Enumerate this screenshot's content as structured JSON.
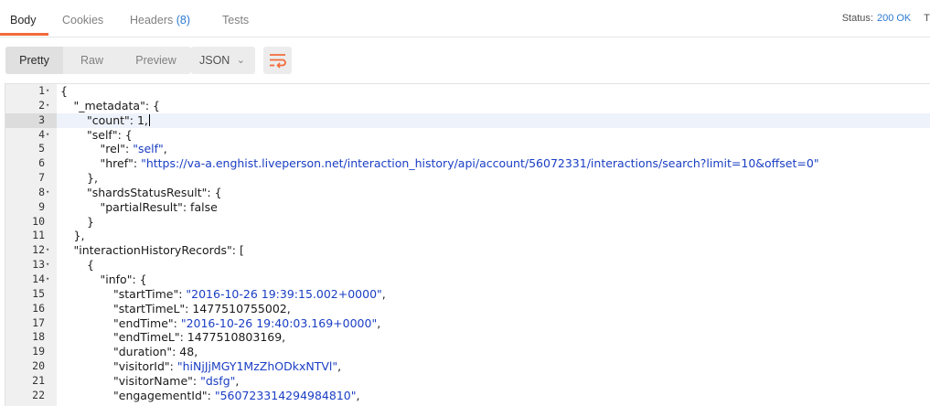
{
  "tabs": [
    {
      "label": "Body",
      "active": true
    },
    {
      "label": "Cookies",
      "active": false
    },
    {
      "label": "Headers",
      "count": "(8)",
      "active": false
    },
    {
      "label": "Tests",
      "active": false
    }
  ],
  "status": {
    "label": "Status:",
    "value": "200 OK",
    "trail": "T"
  },
  "toolbar": {
    "view_modes": [
      "Pretty",
      "Raw",
      "Preview"
    ],
    "active_mode": "Pretty",
    "format": "JSON",
    "wrap_icon": "wrap-lines-icon"
  },
  "colors": {
    "accent": "#f26b3a",
    "link": "#2e7ad1",
    "string": "#1a3ec4"
  },
  "editor": {
    "current_line": 3,
    "lines": [
      {
        "n": "1",
        "fold": true,
        "indent": 0,
        "parts": [
          [
            "p",
            "{"
          ]
        ]
      },
      {
        "n": "2",
        "fold": true,
        "indent": 1,
        "parts": [
          [
            "k",
            "\"_metadata\""
          ],
          [
            "p",
            ": {"
          ]
        ]
      },
      {
        "n": "3",
        "fold": false,
        "indent": 2,
        "parts": [
          [
            "k",
            "\"count\""
          ],
          [
            "p",
            ": 1,"
          ]
        ],
        "caret": true
      },
      {
        "n": "4",
        "fold": true,
        "indent": 2,
        "parts": [
          [
            "k",
            "\"self\""
          ],
          [
            "p",
            ": {"
          ]
        ]
      },
      {
        "n": "5",
        "fold": false,
        "indent": 3,
        "parts": [
          [
            "k",
            "\"rel\""
          ],
          [
            "p",
            ": "
          ],
          [
            "s",
            "\"self\""
          ],
          [
            "p",
            ","
          ]
        ]
      },
      {
        "n": "6",
        "fold": false,
        "indent": 3,
        "parts": [
          [
            "k",
            "\"href\""
          ],
          [
            "p",
            ": "
          ],
          [
            "s",
            "\"https://va-a.enghist.liveperson.net/interaction_history/api/account/56072331/interactions/search?limit=10&offset=0\""
          ]
        ]
      },
      {
        "n": "7",
        "fold": false,
        "indent": 2,
        "parts": [
          [
            "p",
            "},"
          ]
        ]
      },
      {
        "n": "8",
        "fold": true,
        "indent": 2,
        "parts": [
          [
            "k",
            "\"shardsStatusResult\""
          ],
          [
            "p",
            ": {"
          ]
        ]
      },
      {
        "n": "9",
        "fold": false,
        "indent": 3,
        "parts": [
          [
            "k",
            "\"partialResult\""
          ],
          [
            "p",
            ": false"
          ]
        ]
      },
      {
        "n": "10",
        "fold": false,
        "indent": 2,
        "parts": [
          [
            "p",
            "}"
          ]
        ]
      },
      {
        "n": "11",
        "fold": false,
        "indent": 1,
        "parts": [
          [
            "p",
            "},"
          ]
        ]
      },
      {
        "n": "12",
        "fold": true,
        "indent": 1,
        "parts": [
          [
            "k",
            "\"interactionHistoryRecords\""
          ],
          [
            "p",
            ": ["
          ]
        ]
      },
      {
        "n": "13",
        "fold": true,
        "indent": 2,
        "parts": [
          [
            "p",
            "{"
          ]
        ]
      },
      {
        "n": "14",
        "fold": true,
        "indent": 3,
        "parts": [
          [
            "k",
            "\"info\""
          ],
          [
            "p",
            ": {"
          ]
        ]
      },
      {
        "n": "15",
        "fold": false,
        "indent": 4,
        "parts": [
          [
            "k",
            "\"startTime\""
          ],
          [
            "p",
            ": "
          ],
          [
            "s",
            "\"2016-10-26 19:39:15.002+0000\""
          ],
          [
            "p",
            ","
          ]
        ]
      },
      {
        "n": "16",
        "fold": false,
        "indent": 4,
        "parts": [
          [
            "k",
            "\"startTimeL\""
          ],
          [
            "p",
            ": 1477510755002,"
          ]
        ]
      },
      {
        "n": "17",
        "fold": false,
        "indent": 4,
        "parts": [
          [
            "k",
            "\"endTime\""
          ],
          [
            "p",
            ": "
          ],
          [
            "s",
            "\"2016-10-26 19:40:03.169+0000\""
          ],
          [
            "p",
            ","
          ]
        ]
      },
      {
        "n": "18",
        "fold": false,
        "indent": 4,
        "parts": [
          [
            "k",
            "\"endTimeL\""
          ],
          [
            "p",
            ": 1477510803169,"
          ]
        ]
      },
      {
        "n": "19",
        "fold": false,
        "indent": 4,
        "parts": [
          [
            "k",
            "\"duration\""
          ],
          [
            "p",
            ": 48,"
          ]
        ]
      },
      {
        "n": "20",
        "fold": false,
        "indent": 4,
        "parts": [
          [
            "k",
            "\"visitorId\""
          ],
          [
            "p",
            ": "
          ],
          [
            "s",
            "\"hiNjJjMGY1MzZhODkxNTVl\""
          ],
          [
            "p",
            ","
          ]
        ]
      },
      {
        "n": "21",
        "fold": false,
        "indent": 4,
        "parts": [
          [
            "k",
            "\"visitorName\""
          ],
          [
            "p",
            ": "
          ],
          [
            "s",
            "\"dsfg\""
          ],
          [
            "p",
            ","
          ]
        ]
      },
      {
        "n": "22",
        "fold": false,
        "indent": 4,
        "parts": [
          [
            "k",
            "\"engagementId\""
          ],
          [
            "p",
            ": "
          ],
          [
            "s",
            "\"560723314294984810\""
          ],
          [
            "p",
            ","
          ]
        ]
      }
    ]
  }
}
